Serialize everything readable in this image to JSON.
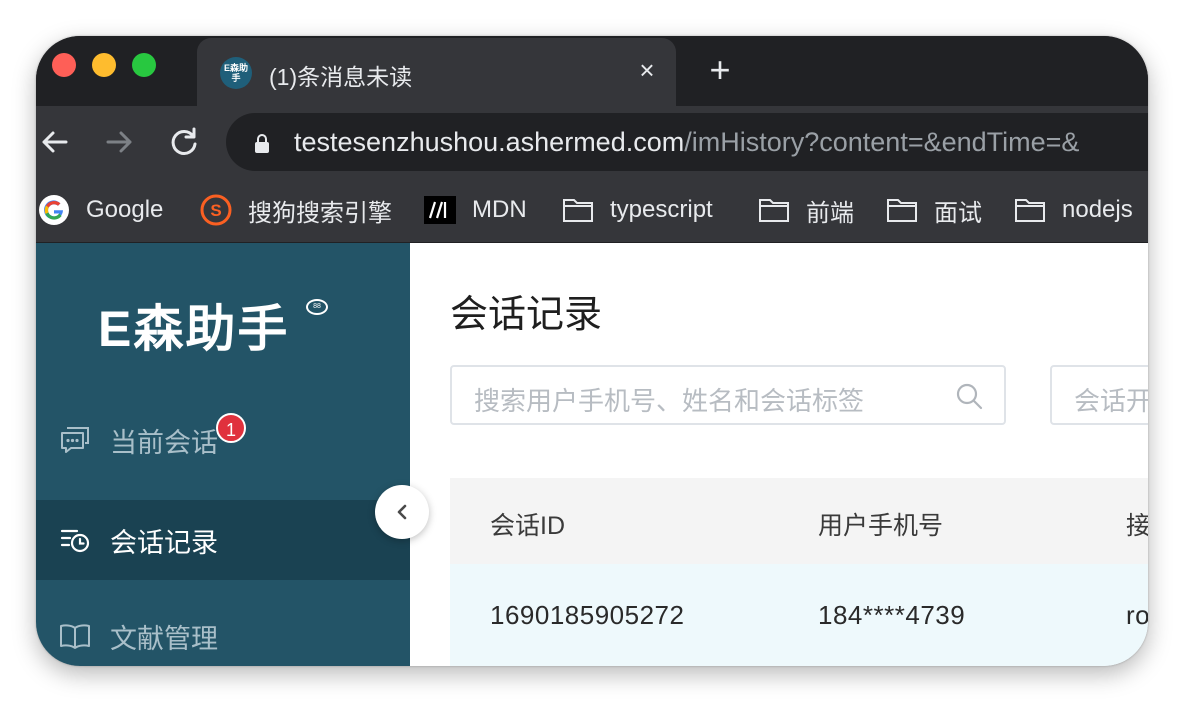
{
  "browser": {
    "tab": {
      "favicon_text": "E森助手",
      "title": "(1)条消息未读",
      "close": "×"
    },
    "new_tab": "+",
    "address": {
      "host": "testesenzhushou.ashermed.com",
      "path": "/imHistory?content=&endTime=&"
    },
    "bookmarks": [
      {
        "label": "Google",
        "icon": "google-icon"
      },
      {
        "label": "搜狗搜索引擎",
        "icon": "sogou-icon"
      },
      {
        "label": "MDN",
        "icon": "mdn-icon"
      },
      {
        "label": "typescript",
        "icon": "folder-icon"
      },
      {
        "label": "前端",
        "icon": "folder-icon"
      },
      {
        "label": "面试",
        "icon": "folder-icon"
      },
      {
        "label": "nodejs",
        "icon": "folder-icon"
      }
    ]
  },
  "sidebar": {
    "logo": "E森助手",
    "logo_badge": "88",
    "items": [
      {
        "label": "当前会话",
        "icon": "chat-icon",
        "badge": "1"
      },
      {
        "label": "会话记录",
        "icon": "history-icon",
        "active": true
      },
      {
        "label": "文献管理",
        "icon": "book-icon"
      }
    ]
  },
  "main": {
    "title": "会话记录",
    "search_placeholder": "搜索用户手机号、姓名和会话标签",
    "date_placeholder": "会话开",
    "table": {
      "headers": [
        "会话ID",
        "用户手机号",
        "接"
      ],
      "rows": [
        [
          "1690185905272",
          "184****4739",
          "ro"
        ]
      ]
    }
  },
  "colors": {
    "sidebar_bg": "#235467",
    "sidebar_active": "#1a4252",
    "row_highlight": "#eef9fc",
    "badge": "#e0313d"
  }
}
